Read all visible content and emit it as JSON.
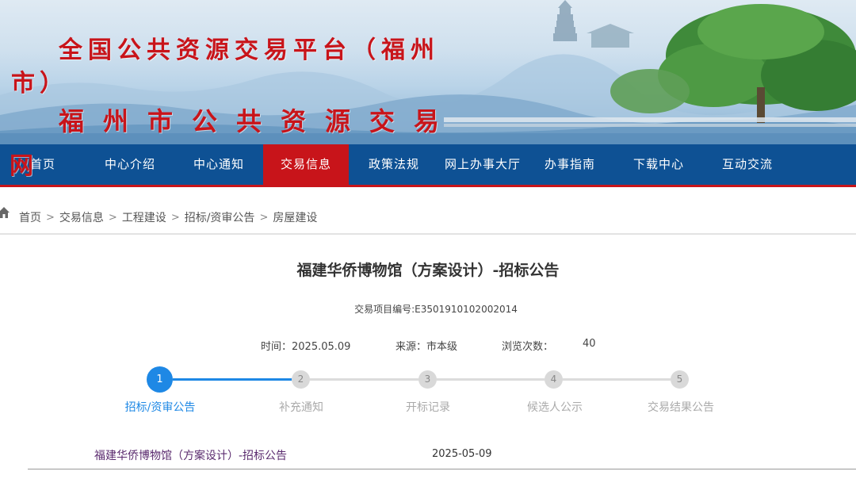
{
  "banner": {
    "title_line1": "全国公共资源交易平台（福州",
    "title_line1_cont": "市）",
    "title_line2": "福州市公共资源交易",
    "title_line2_cont": "网"
  },
  "nav": {
    "items": [
      {
        "label": "首页"
      },
      {
        "label": "中心介绍"
      },
      {
        "label": "中心通知"
      },
      {
        "label": "交易信息"
      },
      {
        "label": "政策法规"
      },
      {
        "label": "网上办事大厅"
      },
      {
        "label": "办事指南"
      },
      {
        "label": "下载中心"
      },
      {
        "label": "互动交流"
      }
    ],
    "active": "交易信息"
  },
  "breadcrumb": {
    "icon": "home-icon",
    "items": [
      "首页",
      "交易信息",
      "工程建设",
      "招标/资审公告",
      "房屋建设"
    ],
    "separator": ">"
  },
  "article": {
    "title": "福建华侨博物馆（方案设计）-招标公告",
    "project_code": "交易项目编号:E3501910102002014",
    "time": "时间：2025.05.09",
    "source": "来源：市本级",
    "views_label": "浏览次数：",
    "views": "40"
  },
  "steps": {
    "current": 1,
    "items": [
      {
        "num": "1",
        "label": "招标/资审公告"
      },
      {
        "num": "2",
        "label": "补充通知"
      },
      {
        "num": "3",
        "label": "开标记录"
      },
      {
        "num": "4",
        "label": "候选人公示"
      },
      {
        "num": "5",
        "label": "交易结果公告"
      }
    ]
  },
  "documents": [
    {
      "title": "福建华侨博物馆（方案设计）-招标公告",
      "date": "2025-05-09"
    }
  ],
  "colors": {
    "nav_bg": "#0e5194",
    "nav_active": "#c8141a",
    "banner_title": "#c8141a",
    "step_active": "#1e88e5",
    "link": "#5a2a6e"
  }
}
